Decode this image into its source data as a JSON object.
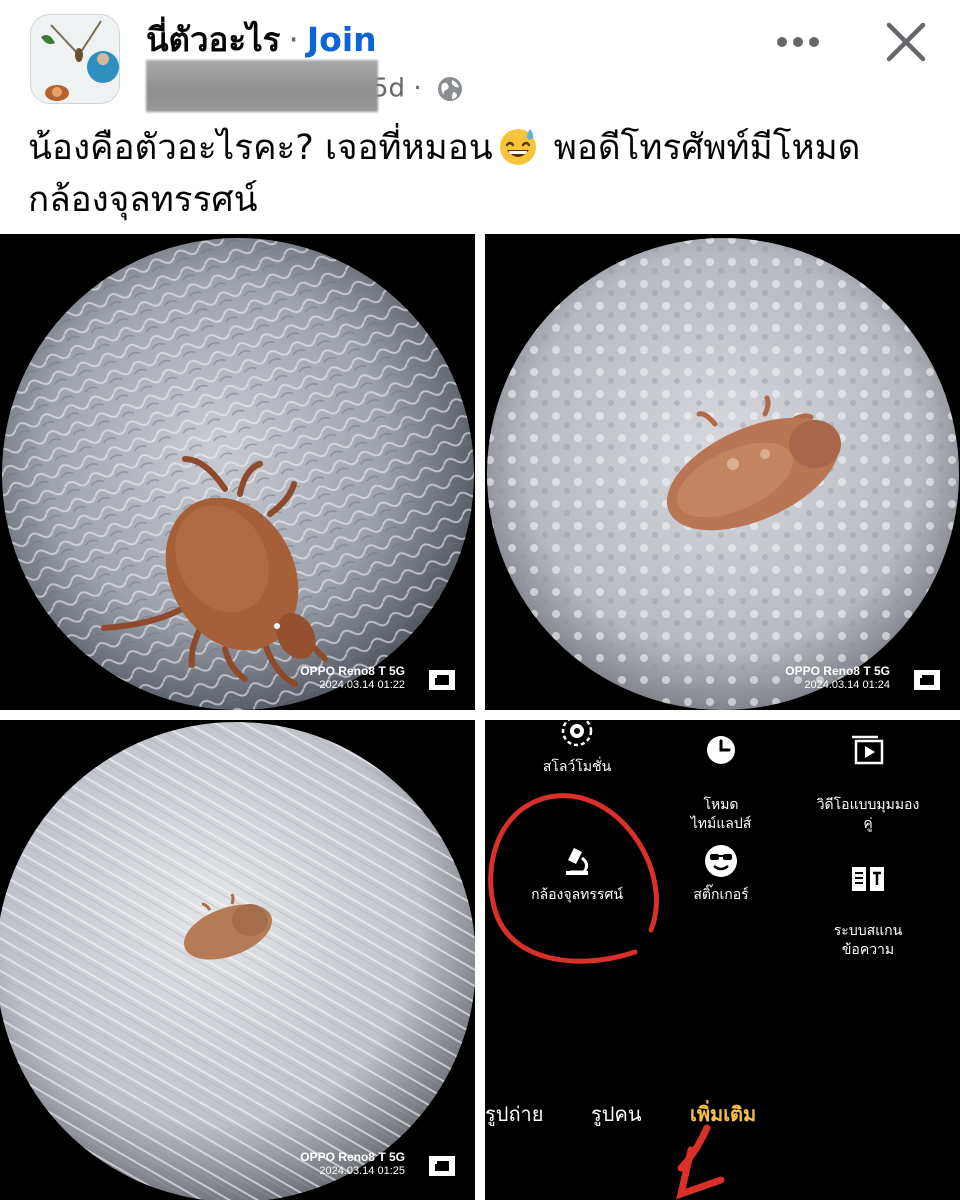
{
  "post": {
    "group_name": "นี่ตัวอะไร",
    "separator": "·",
    "join_label": "Join",
    "time_ago": "5d",
    "meta_separator": "·",
    "text_line1": "น้องคือตัวอะไรคะ? เจอที่หมอน",
    "text_line1_after_emoji": "พอดีโทรศัพท์มีโหมด",
    "text_line2": "กล้องจุลทรรศน์",
    "emoji": "grinning-face-with-sweat"
  },
  "photos": [
    {
      "camera": "OPPO Reno8 T 5G",
      "timestamp": "2024.03.14 01:22"
    },
    {
      "camera": "OPPO Reno8 T 5G",
      "timestamp": "2024.03.14 01:24"
    },
    {
      "camera": "OPPO Reno8 T 5G",
      "timestamp": "2024.03.14 01:25"
    }
  ],
  "camera_menu": {
    "items": [
      {
        "label": "สโลว์โมชั่น",
        "icon": "slow-motion-icon"
      },
      {
        "label": "โหมด\nไทม์แลปส์",
        "icon": "timelapse-icon"
      },
      {
        "label": "วิดีโอแบบมุมมอง\nคู่",
        "icon": "dual-view-video-icon"
      },
      {
        "label": "กล้องจุลทรรศน์",
        "icon": "microscope-icon"
      },
      {
        "label": "สติ๊กเกอร์",
        "icon": "sticker-icon"
      },
      {
        "label": "ระบบสแกน\nข้อความ",
        "icon": "text-scan-icon"
      }
    ],
    "tabs": [
      {
        "label": "รูปถ่าย",
        "active": false
      },
      {
        "label": "รูปคน",
        "active": false
      },
      {
        "label": "เพิ่มเติม",
        "active": true
      }
    ]
  },
  "colors": {
    "join": "#0a66d8",
    "secondary_text": "#65676b",
    "annotation_red": "#d9302a",
    "active_tab": "#f6c243"
  }
}
